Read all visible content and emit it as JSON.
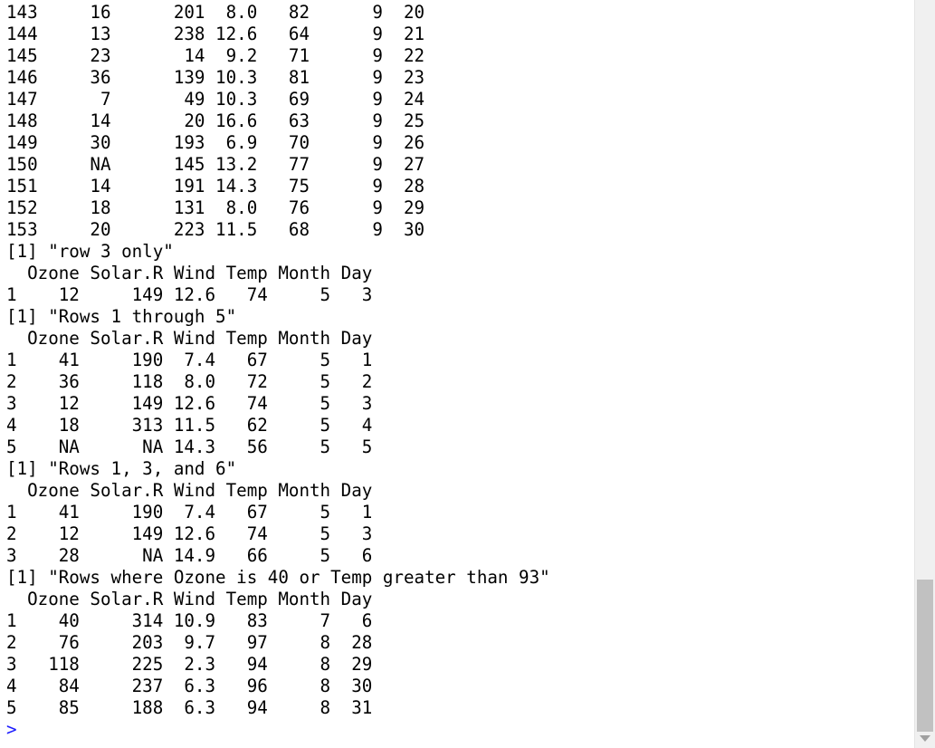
{
  "console": {
    "lines": [
      "143     16      201  8.0   82      9  20",
      "144     13      238 12.6   64      9  21",
      "145     23       14  9.2   71      9  22",
      "146     36      139 10.3   81      9  23",
      "147      7       49 10.3   69      9  24",
      "148     14       20 16.6   63      9  25",
      "149     30      193  6.9   70      9  26",
      "150     NA      145 13.2   77      9  27",
      "151     14      191 14.3   75      9  28",
      "152     18      131  8.0   76      9  29",
      "153     20      223 11.5   68      9  30",
      "[1] \"row 3 only\"",
      "  Ozone Solar.R Wind Temp Month Day",
      "1    12     149 12.6   74     5   3",
      "[1] \"Rows 1 through 5\"",
      "  Ozone Solar.R Wind Temp Month Day",
      "1    41     190  7.4   67     5   1",
      "2    36     118  8.0   72     5   2",
      "3    12     149 12.6   74     5   3",
      "4    18     313 11.5   62     5   4",
      "5    NA      NA 14.3   56     5   5",
      "[1] \"Rows 1, 3, and 6\"",
      "  Ozone Solar.R Wind Temp Month Day",
      "1    41     190  7.4   67     5   1",
      "2    12     149 12.6   74     5   3",
      "3    28      NA 14.9   66     5   6",
      "[1] \"Rows where Ozone is 40 or Temp greater than 93\"",
      "  Ozone Solar.R Wind Temp Month Day",
      "1    40     314 10.9   83     7   6",
      "2    76     203  9.7   97     8  28",
      "3   118     225  2.3   94     8  29",
      "4    84     237  6.3   96     8  30",
      "5    85     188  6.3   94     8  31"
    ],
    "prompt": ">",
    "prompt_color": "#1a1aff"
  }
}
